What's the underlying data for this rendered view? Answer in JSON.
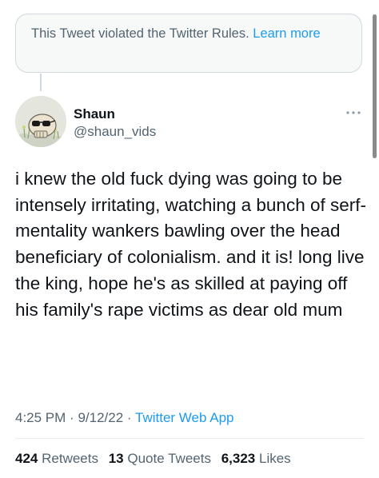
{
  "violation": {
    "text": "This Tweet violated the Twitter Rules.",
    "link": "Learn more"
  },
  "author": {
    "display_name": "Shaun",
    "handle": "@shaun_vids"
  },
  "tweet": {
    "text": "i knew the old fuck dying was going to be intensely irritating, watching a bunch of serf-mentality wankers bawling over the head beneficiary of colonialism. and it is! long live the king, hope he's as skilled at paying off his family's rape victims as dear old mum"
  },
  "meta": {
    "time": "4:25 PM",
    "separator": "·",
    "date": "9/12/22",
    "source": "Twitter Web App"
  },
  "stats": {
    "retweets_count": "424",
    "retweets_label": "Retweets",
    "quotes_count": "13",
    "quotes_label": "Quote Tweets",
    "likes_count": "6,323",
    "likes_label": "Likes"
  },
  "icons": {
    "more": "more-horizontal-icon",
    "avatar": "skull-avatar"
  },
  "colors": {
    "text": "#0f1419",
    "secondary": "#536471",
    "link": "#1d9bf0",
    "border": "#cfd9de",
    "notice_bg": "#f7f9f9"
  }
}
